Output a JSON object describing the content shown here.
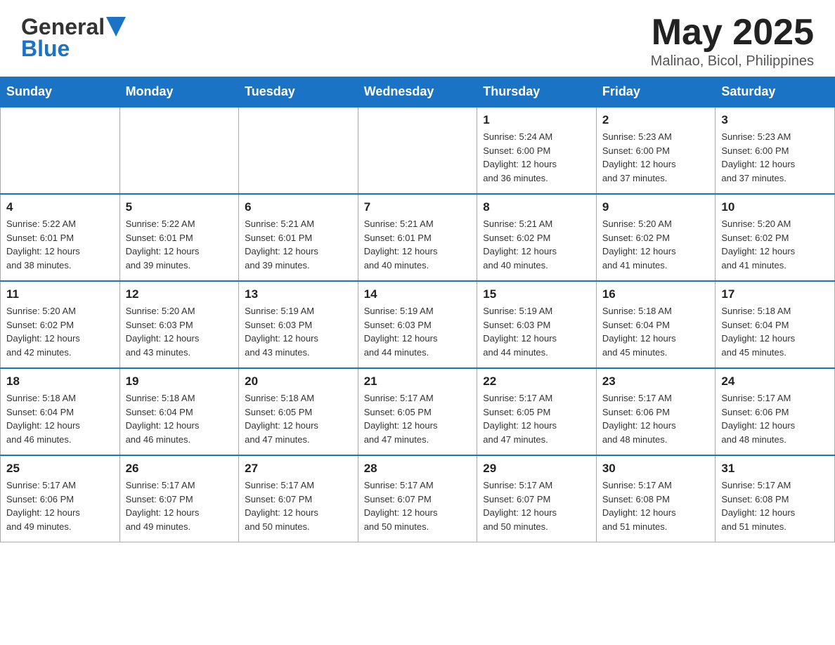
{
  "header": {
    "logo_general": "General",
    "logo_blue": "Blue",
    "month_year": "May 2025",
    "location": "Malinao, Bicol, Philippines"
  },
  "days_of_week": [
    "Sunday",
    "Monday",
    "Tuesday",
    "Wednesday",
    "Thursday",
    "Friday",
    "Saturday"
  ],
  "weeks": [
    [
      {
        "day": "",
        "info": ""
      },
      {
        "day": "",
        "info": ""
      },
      {
        "day": "",
        "info": ""
      },
      {
        "day": "",
        "info": ""
      },
      {
        "day": "1",
        "info": "Sunrise: 5:24 AM\nSunset: 6:00 PM\nDaylight: 12 hours\nand 36 minutes."
      },
      {
        "day": "2",
        "info": "Sunrise: 5:23 AM\nSunset: 6:00 PM\nDaylight: 12 hours\nand 37 minutes."
      },
      {
        "day": "3",
        "info": "Sunrise: 5:23 AM\nSunset: 6:00 PM\nDaylight: 12 hours\nand 37 minutes."
      }
    ],
    [
      {
        "day": "4",
        "info": "Sunrise: 5:22 AM\nSunset: 6:01 PM\nDaylight: 12 hours\nand 38 minutes."
      },
      {
        "day": "5",
        "info": "Sunrise: 5:22 AM\nSunset: 6:01 PM\nDaylight: 12 hours\nand 39 minutes."
      },
      {
        "day": "6",
        "info": "Sunrise: 5:21 AM\nSunset: 6:01 PM\nDaylight: 12 hours\nand 39 minutes."
      },
      {
        "day": "7",
        "info": "Sunrise: 5:21 AM\nSunset: 6:01 PM\nDaylight: 12 hours\nand 40 minutes."
      },
      {
        "day": "8",
        "info": "Sunrise: 5:21 AM\nSunset: 6:02 PM\nDaylight: 12 hours\nand 40 minutes."
      },
      {
        "day": "9",
        "info": "Sunrise: 5:20 AM\nSunset: 6:02 PM\nDaylight: 12 hours\nand 41 minutes."
      },
      {
        "day": "10",
        "info": "Sunrise: 5:20 AM\nSunset: 6:02 PM\nDaylight: 12 hours\nand 41 minutes."
      }
    ],
    [
      {
        "day": "11",
        "info": "Sunrise: 5:20 AM\nSunset: 6:02 PM\nDaylight: 12 hours\nand 42 minutes."
      },
      {
        "day": "12",
        "info": "Sunrise: 5:20 AM\nSunset: 6:03 PM\nDaylight: 12 hours\nand 43 minutes."
      },
      {
        "day": "13",
        "info": "Sunrise: 5:19 AM\nSunset: 6:03 PM\nDaylight: 12 hours\nand 43 minutes."
      },
      {
        "day": "14",
        "info": "Sunrise: 5:19 AM\nSunset: 6:03 PM\nDaylight: 12 hours\nand 44 minutes."
      },
      {
        "day": "15",
        "info": "Sunrise: 5:19 AM\nSunset: 6:03 PM\nDaylight: 12 hours\nand 44 minutes."
      },
      {
        "day": "16",
        "info": "Sunrise: 5:18 AM\nSunset: 6:04 PM\nDaylight: 12 hours\nand 45 minutes."
      },
      {
        "day": "17",
        "info": "Sunrise: 5:18 AM\nSunset: 6:04 PM\nDaylight: 12 hours\nand 45 minutes."
      }
    ],
    [
      {
        "day": "18",
        "info": "Sunrise: 5:18 AM\nSunset: 6:04 PM\nDaylight: 12 hours\nand 46 minutes."
      },
      {
        "day": "19",
        "info": "Sunrise: 5:18 AM\nSunset: 6:04 PM\nDaylight: 12 hours\nand 46 minutes."
      },
      {
        "day": "20",
        "info": "Sunrise: 5:18 AM\nSunset: 6:05 PM\nDaylight: 12 hours\nand 47 minutes."
      },
      {
        "day": "21",
        "info": "Sunrise: 5:17 AM\nSunset: 6:05 PM\nDaylight: 12 hours\nand 47 minutes."
      },
      {
        "day": "22",
        "info": "Sunrise: 5:17 AM\nSunset: 6:05 PM\nDaylight: 12 hours\nand 47 minutes."
      },
      {
        "day": "23",
        "info": "Sunrise: 5:17 AM\nSunset: 6:06 PM\nDaylight: 12 hours\nand 48 minutes."
      },
      {
        "day": "24",
        "info": "Sunrise: 5:17 AM\nSunset: 6:06 PM\nDaylight: 12 hours\nand 48 minutes."
      }
    ],
    [
      {
        "day": "25",
        "info": "Sunrise: 5:17 AM\nSunset: 6:06 PM\nDaylight: 12 hours\nand 49 minutes."
      },
      {
        "day": "26",
        "info": "Sunrise: 5:17 AM\nSunset: 6:07 PM\nDaylight: 12 hours\nand 49 minutes."
      },
      {
        "day": "27",
        "info": "Sunrise: 5:17 AM\nSunset: 6:07 PM\nDaylight: 12 hours\nand 50 minutes."
      },
      {
        "day": "28",
        "info": "Sunrise: 5:17 AM\nSunset: 6:07 PM\nDaylight: 12 hours\nand 50 minutes."
      },
      {
        "day": "29",
        "info": "Sunrise: 5:17 AM\nSunset: 6:07 PM\nDaylight: 12 hours\nand 50 minutes."
      },
      {
        "day": "30",
        "info": "Sunrise: 5:17 AM\nSunset: 6:08 PM\nDaylight: 12 hours\nand 51 minutes."
      },
      {
        "day": "31",
        "info": "Sunrise: 5:17 AM\nSunset: 6:08 PM\nDaylight: 12 hours\nand 51 minutes."
      }
    ]
  ]
}
